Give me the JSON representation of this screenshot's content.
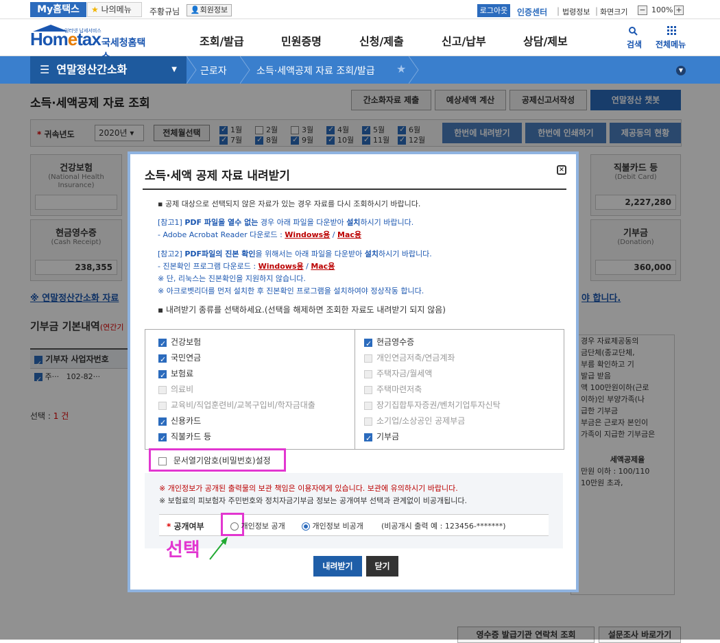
{
  "topbar": {
    "my_hometax": "My홈택스",
    "my_menu": "나의메뉴",
    "user_name": "주황규님",
    "member_info": "회원정보",
    "logout": "로그아웃",
    "auth_center": "인증센터",
    "law_info": "법령정보",
    "screen_size": "화면크기",
    "zoom_minus": "−",
    "zoom_value": "100%",
    "zoom_plus": "+"
  },
  "logo": {
    "tagline": "인터넷 납세서비스",
    "brand_prefix": "Hom",
    "brand_mid": "e",
    "brand_suffix": "tax",
    "agency": "국세청홈택스",
    "brand_color": "#1a56b0"
  },
  "gnb": {
    "items": [
      "조회/발급",
      "민원증명",
      "신청/제출",
      "신고/납부",
      "상담/제보"
    ],
    "search": "검색",
    "all_menu": "전체메뉴"
  },
  "nav": {
    "section": "연말정산간소화",
    "crumbs": [
      "근로자",
      "소득·세액공제 자료 조회/발급"
    ]
  },
  "page": {
    "title": "소득·세액공제 자료 조회",
    "buttons": [
      "간소화자료 제출",
      "예상세액 계산",
      "공제신고서작성",
      "연말정산 챗봇"
    ],
    "filter": {
      "year_label": "귀속년도",
      "year_value": "2020년",
      "select_all": "전체월선택",
      "months": [
        "1월",
        "2월",
        "3월",
        "4월",
        "5월",
        "6월",
        "7월",
        "8월",
        "9월",
        "10월",
        "11월",
        "12월"
      ],
      "months_checked": [
        true,
        false,
        false,
        true,
        true,
        true,
        true,
        true,
        true,
        true,
        true,
        true
      ],
      "download_all": "한번에 내려받기",
      "print_all": "한번에 인쇄하기",
      "status": "제공동의 현황"
    },
    "cards": {
      "health": {
        "title": "건강보험",
        "sub": "(National Health Insurance)",
        "value": ""
      },
      "debit": {
        "title": "직불카드 등",
        "sub": "(Debit Card)",
        "value": "2,227,280"
      },
      "cash": {
        "title": "현금영수증",
        "sub": "(Cash Receipt)",
        "value": "238,355"
      },
      "donation": {
        "title": "기부금",
        "sub": "(Donation)",
        "value": "360,000"
      }
    },
    "note_left": "※ 연말정산간소화 자료",
    "note_right": "야 합니다.",
    "donation_head": "기부금 기본내역",
    "donation_head_sub": "(연간기",
    "donation_cols": [
      "기부자",
      "사업자번호"
    ],
    "donation_row": [
      "주···",
      "102-82···"
    ],
    "selected_label": "선택 :",
    "selected_count": "1 건",
    "right_panel_lines": [
      "경우 자료제공동의",
      "금단체(종교단체,",
      "부름 확인하고 기",
      "발급 받음",
      "액 100만원이하(근로",
      "이하)인 부양가족(나",
      "급한 기부금",
      "부금은 근로자 본인이",
      "가족이 지급한 기부금은",
      "세액공제율",
      "만원 이하 : 100/110",
      "10만원 초과,"
    ],
    "bottom_buttons": [
      "영수증 발급기관 연락처 조회",
      "설문조사 바로가기"
    ]
  },
  "modal": {
    "title": "소득·세액 공제 자료 내려받기",
    "info1": "▪ 공제 대상으로 선택되지 않은 자료가 있는 경우 자료를 다시 조회하시기 바랍니다.",
    "ref1_a": "[참고1] ",
    "ref1_b": "PDF 파일을 열수 없는",
    "ref1_c": " 경우  아래 파일을 다운받아 ",
    "ref1_d": "설치",
    "ref1_e": "하시기 바랍니다.",
    "ref1b_a": "- Adobe Acrobat Reader 다운로드 : ",
    "windows": "Windows용",
    "slash": " / ",
    "mac": "Mac용",
    "ref2_a": "[참고2] ",
    "ref2_b": "PDF파일의 진본 확인",
    "ref2_c": "을 위해서는 아래 파일을 다운받아 ",
    "ref2_d": "설치",
    "ref2_e": "하시기 바랍니다.",
    "ref2b_a": "- 진본확인 프로그램 다운로드 : ",
    "ref2c": "※ 단, 리눅스는 진본확인을 지원하지 않습니다.",
    "ref2d": "※ 아크로벳리더를 먼저 설치한 후 진본확인 프로그램을 설치하여야 정상작동 합니다.",
    "info2": "▪ 내려받기 종류를 선택하세요.(선택을 해제하면 조회한 자료도 내려받기 되지 않음)",
    "left_items": [
      {
        "label": "건강보험",
        "checked": true,
        "disabled": false
      },
      {
        "label": "국민연금",
        "checked": true,
        "disabled": false
      },
      {
        "label": "보험료",
        "checked": true,
        "disabled": false
      },
      {
        "label": "의료비",
        "checked": false,
        "disabled": true
      },
      {
        "label": "교육비/직업훈련비/교복구입비/학자금대출",
        "checked": false,
        "disabled": true
      },
      {
        "label": "신용카드",
        "checked": true,
        "disabled": false
      },
      {
        "label": "직불카드 등",
        "checked": true,
        "disabled": false
      }
    ],
    "right_items": [
      {
        "label": "현금영수증",
        "checked": true,
        "disabled": false
      },
      {
        "label": "개인연금저축/연금계좌",
        "checked": false,
        "disabled": true
      },
      {
        "label": "주택자금/월세액",
        "checked": false,
        "disabled": true
      },
      {
        "label": "주택마련저축",
        "checked": false,
        "disabled": true
      },
      {
        "label": "장기집합투자증권/벤처기업투자신탁",
        "checked": false,
        "disabled": true
      },
      {
        "label": "소기업/소상공인 공제부금",
        "checked": false,
        "disabled": true
      },
      {
        "label": "기부금",
        "checked": true,
        "disabled": false
      }
    ],
    "password_option": "문서열기암호(비밀번호)설정",
    "privacy_warn1": "※ 개인정보가 공개된 출력물의 보관 책임은 이용자에게 있습니다. 보관에 유의하시기 바랍니다.",
    "privacy_warn2": "※ 보험료의 피보험자 주민번호와 정치자금기부금 정보는 공개여부 선택과 관계없이 비공개됩니다.",
    "public_label": "공개여부",
    "radio_public": "개인정보 공개",
    "radio_private": "개인정보 비공개",
    "sample": "(비공개시 출력 예 : 123456-*******)",
    "selected_radio": "private",
    "annotation": "선택",
    "download": "내려받기",
    "close": "닫기"
  },
  "colors": {
    "accent": "#2b6bbd",
    "highlight": "#e236d0",
    "nav_bar": "#3a7fcd",
    "nav_dark": "#1e5a9e"
  }
}
